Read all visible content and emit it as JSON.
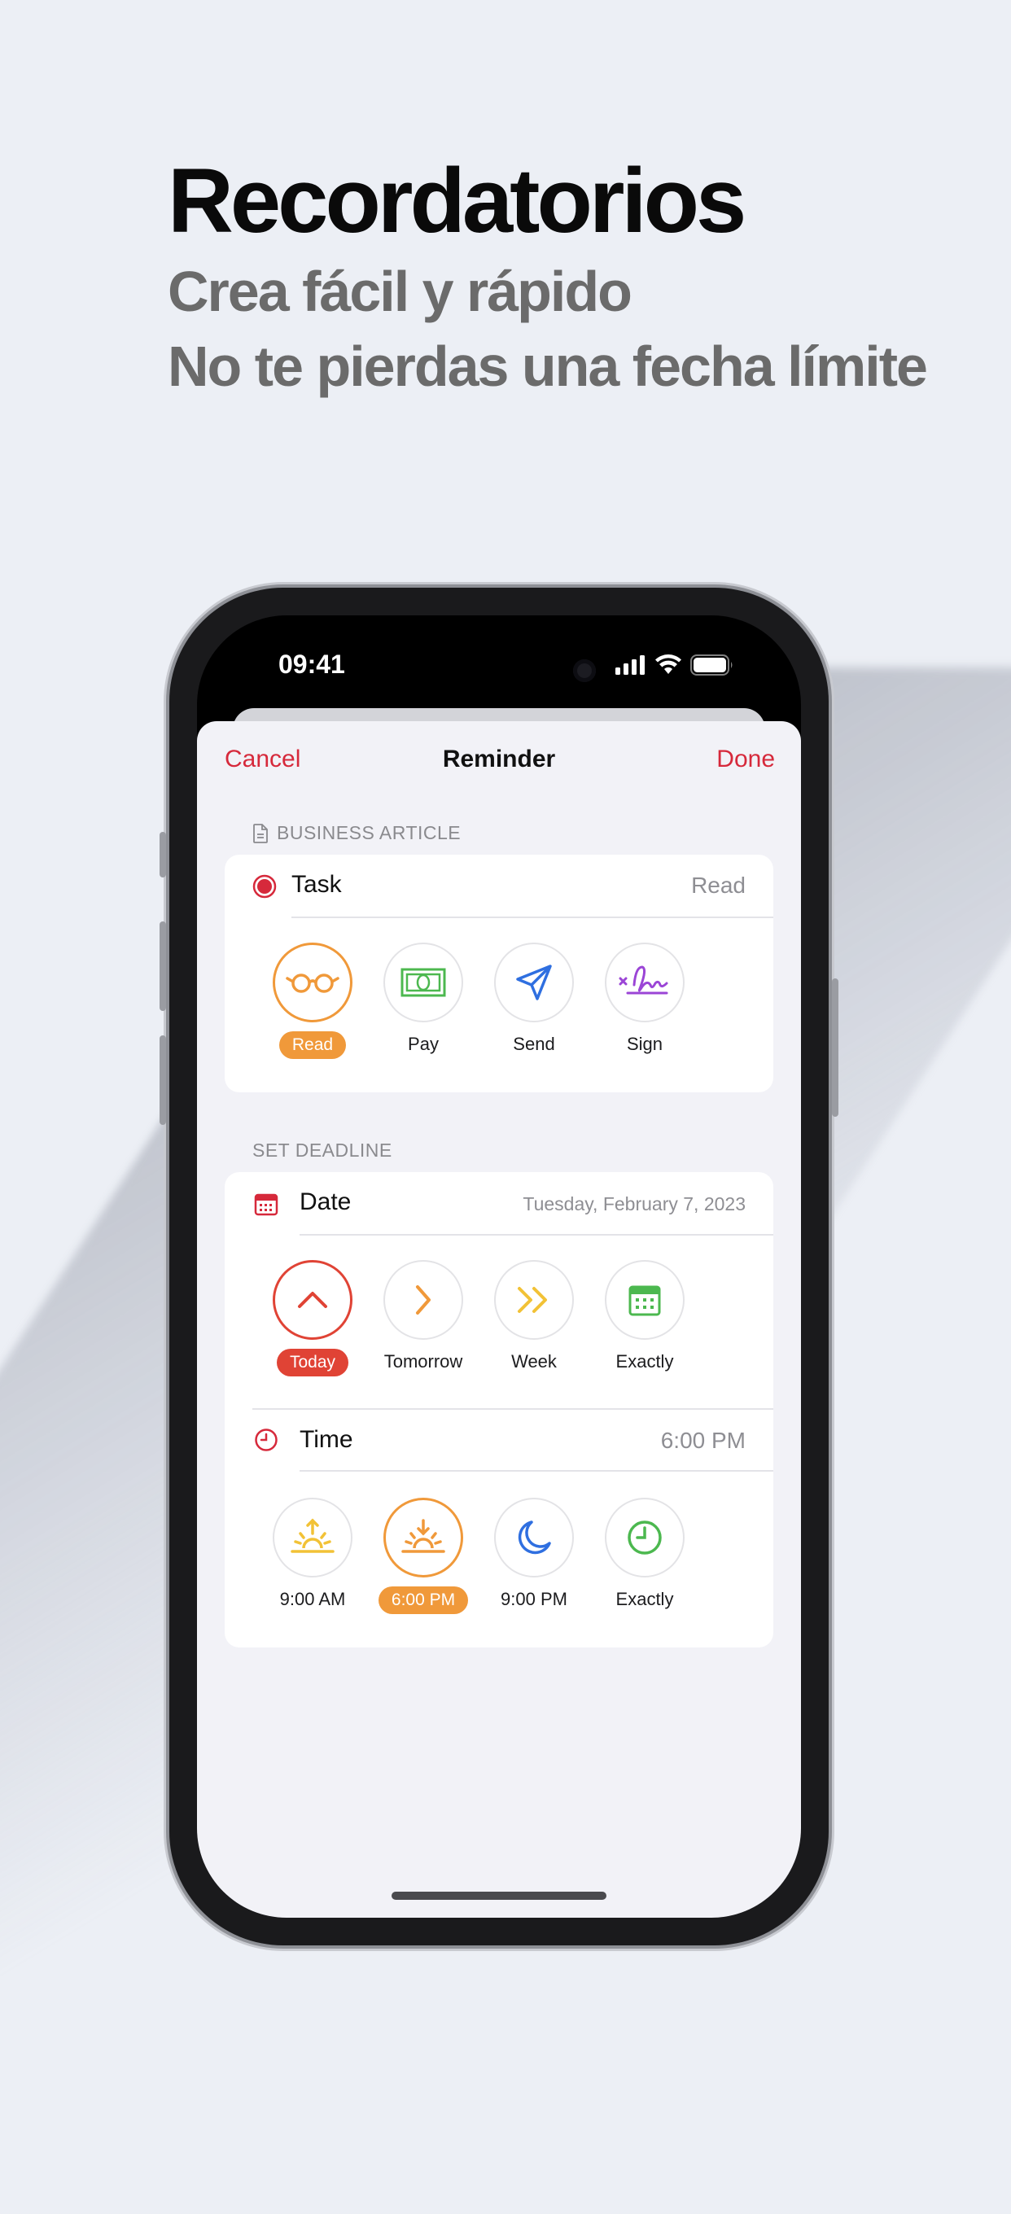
{
  "headline": {
    "title": "Recordatorios",
    "subtitle_1": "Crea fácil y rápido",
    "subtitle_2": "No te pierdas una fecha límite"
  },
  "status_bar": {
    "time": "09:41"
  },
  "nav": {
    "cancel": "Cancel",
    "title": "Reminder",
    "done": "Done"
  },
  "article": {
    "section_label": "BUSINESS ARTICLE",
    "task_label": "Task",
    "task_value": "Read",
    "actions": [
      {
        "label": "Read",
        "icon": "glasses-icon",
        "selected": true,
        "color": "#f0993a"
      },
      {
        "label": "Pay",
        "icon": "banknote-icon",
        "selected": false,
        "color": "#4cb84f"
      },
      {
        "label": "Send",
        "icon": "paper-plane-icon",
        "selected": false,
        "color": "#2f6fe0"
      },
      {
        "label": "Sign",
        "icon": "signature-icon",
        "selected": false,
        "color": "#9b45d6"
      }
    ]
  },
  "deadline": {
    "section_label": "SET DEADLINE",
    "date_label": "Date",
    "date_value": "Tuesday, February 7, 2023",
    "date_options": [
      {
        "label": "Today",
        "icon": "chevron-up-icon",
        "selected": true,
        "color": "#e04335"
      },
      {
        "label": "Tomorrow",
        "icon": "chevron-right-icon",
        "selected": false,
        "color": "#f0993a"
      },
      {
        "label": "Week",
        "icon": "double-chevron-right-icon",
        "selected": false,
        "color": "#f2c236"
      },
      {
        "label": "Exactly",
        "icon": "calendar-icon",
        "selected": false,
        "color": "#4cb84f"
      }
    ],
    "time_label": "Time",
    "time_value": "6:00 PM",
    "time_options": [
      {
        "label": "9:00 AM",
        "icon": "sunrise-icon",
        "selected": false,
        "color": "#f2c236"
      },
      {
        "label": "6:00 PM",
        "icon": "sunset-icon",
        "selected": true,
        "color": "#f0993a"
      },
      {
        "label": "9:00 PM",
        "icon": "moon-icon",
        "selected": false,
        "color": "#2f6fe0"
      },
      {
        "label": "Exactly",
        "icon": "clock-icon",
        "selected": false,
        "color": "#4cb84f"
      }
    ]
  },
  "colors": {
    "accent": "#d6293b",
    "background": "#eceff5",
    "sheet": "#f2f2f7"
  }
}
